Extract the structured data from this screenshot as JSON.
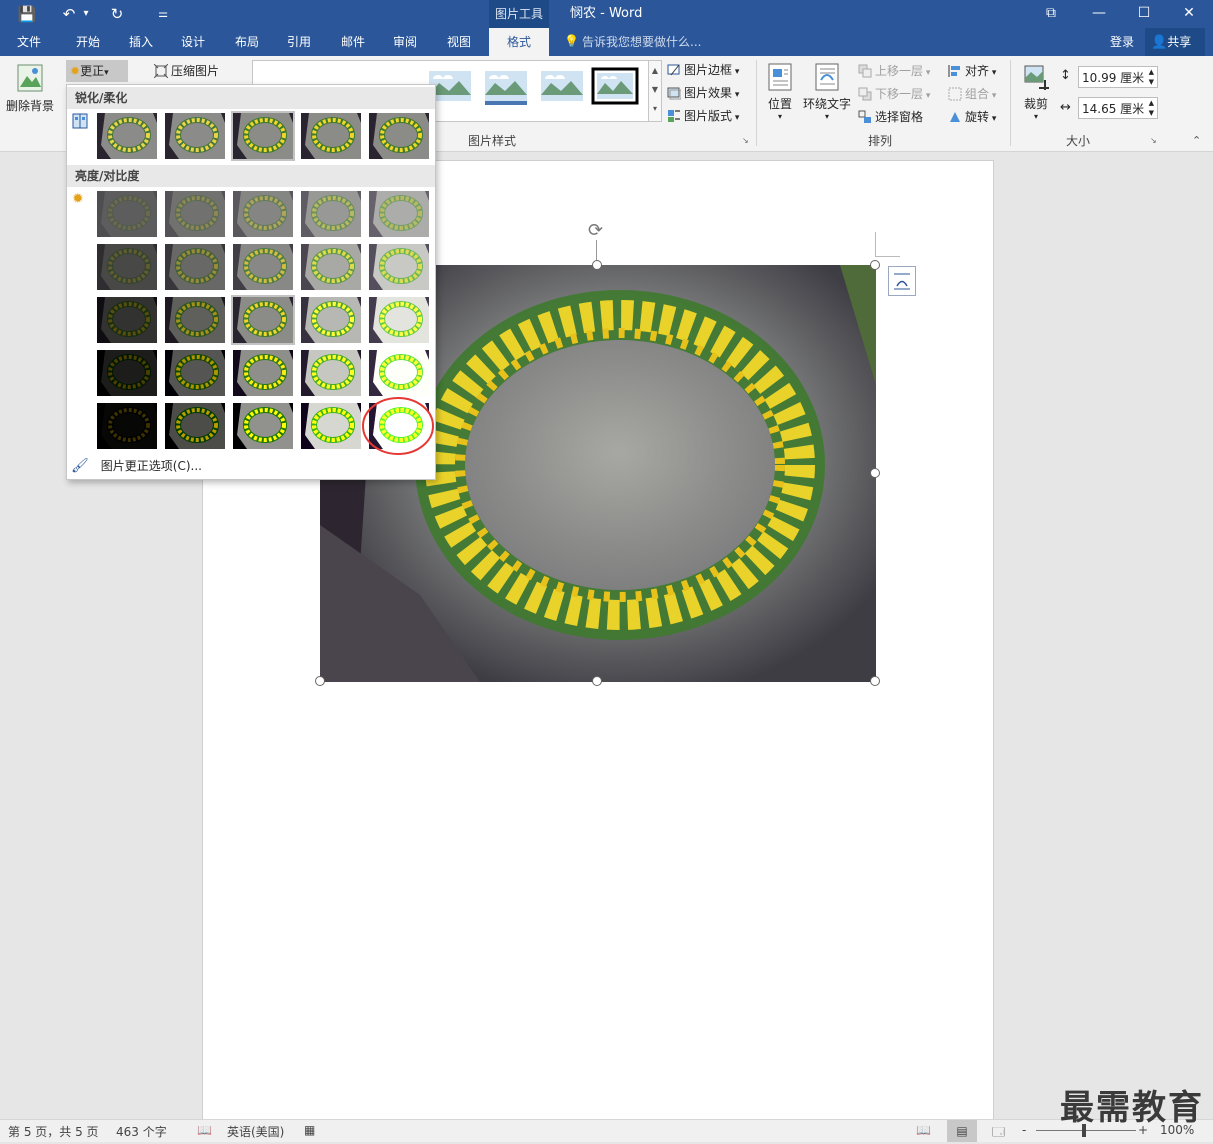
{
  "titlebar": {
    "context_tab": "图片工具",
    "doc_title": "悯农 - Word",
    "qat": {
      "save": "💾",
      "undo": "↶",
      "undo_more": "▾",
      "redo": "↻",
      "customize": "⚌"
    },
    "window_buttons": {
      "restore_ribbon": "⧉",
      "minimize": "—",
      "maximize": "☐",
      "close": "✕"
    }
  },
  "tabs": [
    "文件",
    "开始",
    "插入",
    "设计",
    "布局",
    "引用",
    "邮件",
    "审阅",
    "视图",
    "格式"
  ],
  "active_tab": "格式",
  "tell_me": "告诉我您想要做什么...",
  "login": "登录",
  "share": "共享",
  "ribbon": {
    "remove_bg": "删除背景",
    "corrections": "更正",
    "compress": "压缩图片",
    "styles_label": "图片样式",
    "picture_border": "图片边框",
    "picture_effects": "图片效果",
    "picture_layout": "图片版式",
    "position": "位置",
    "wrap_text": "环绕文字",
    "bring_forward": "上移一层",
    "send_backward": "下移一层",
    "selection_pane": "选择窗格",
    "align": "对齐",
    "group": "组合",
    "rotate": "旋转",
    "arrange_label": "排列",
    "crop": "裁剪",
    "height": "10.99 厘米",
    "width": "14.65 厘米",
    "size_label": "大小"
  },
  "dropdown": {
    "sharpen_header": "锐化/柔化",
    "brightness_header": "亮度/对比度",
    "options_link": "图片更正选项(C)...",
    "sharpen_levels": [
      -0.5,
      -0.25,
      0,
      0.25,
      0.5
    ],
    "brightness_levels": [
      -0.4,
      -0.2,
      0,
      0.2,
      0.4
    ],
    "contrast_levels": [
      -0.4,
      -0.2,
      0,
      0.2,
      0.4
    ]
  },
  "statusbar": {
    "page": "第 5 页，共 5 页",
    "words": "463 个字",
    "language": "英语(美国)",
    "zoom": "100%",
    "zoom_minus": "-",
    "zoom_plus": "+"
  },
  "watermark": "最需教育",
  "colors": {
    "brand": "#2b579a",
    "highlight_circle": "#e53935"
  }
}
